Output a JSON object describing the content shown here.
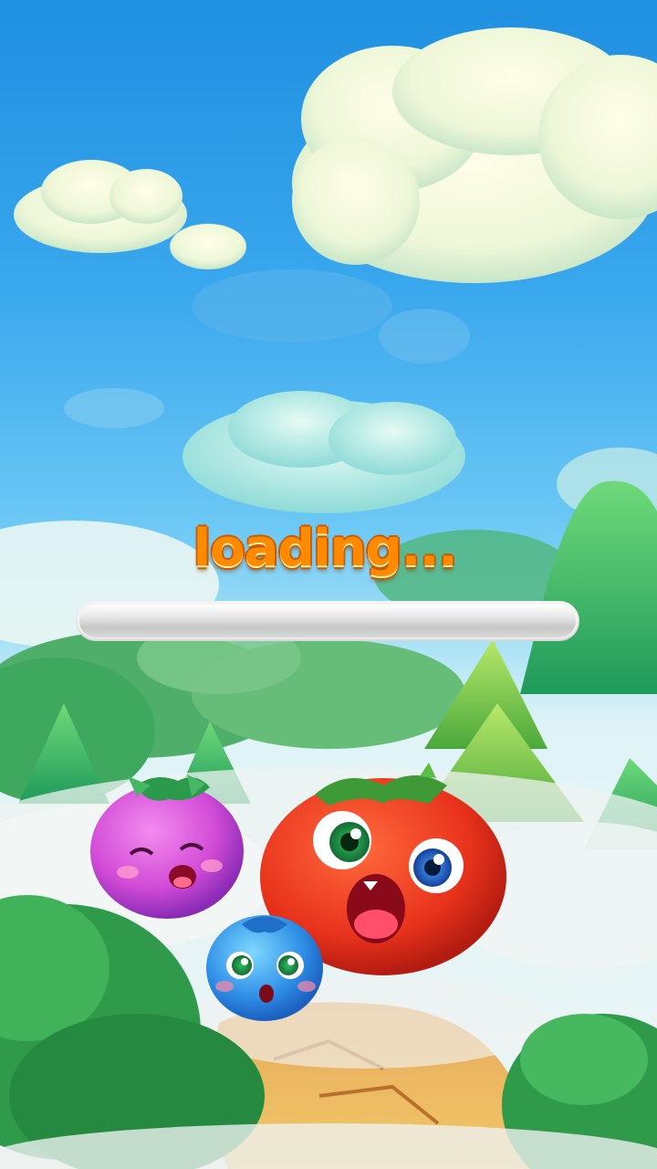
{
  "screen": "loading-screen",
  "loading": {
    "label": "loading...",
    "progress": 0
  },
  "colors": {
    "sky_top": "#1f8fe0",
    "loading_text": "#ff8a00",
    "loading_outline": "#c85a00",
    "bar_track": "#f4f4f4",
    "tomato": "#e8321c",
    "mangosteen": "#d14bd6",
    "blueberry": "#2f8fe6"
  },
  "characters": [
    "mangosteen-character",
    "tomato-character",
    "blueberry-character"
  ]
}
